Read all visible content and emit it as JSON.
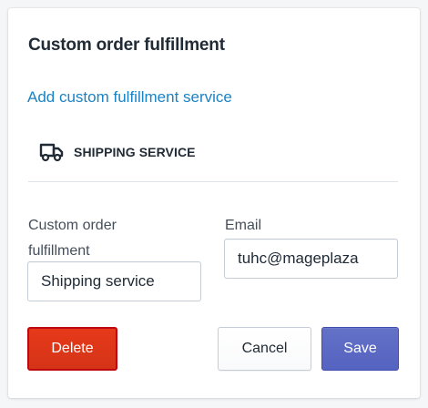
{
  "card": {
    "title": "Custom order fulfillment",
    "add_link": "Add custom fulfillment service",
    "service": {
      "icon": "truck-icon",
      "label": "SHIPPING SERVICE"
    }
  },
  "form": {
    "name_label": "Custom order fulfillment",
    "name_value": "Shipping service",
    "email_label": "Email",
    "email_value": "tuhc@mageplaza"
  },
  "actions": {
    "delete_label": "Delete",
    "cancel_label": "Cancel",
    "save_label": "Save"
  },
  "colors": {
    "link": "#1b83c4",
    "delete": "#de3618",
    "save": "#5c6ac4"
  }
}
